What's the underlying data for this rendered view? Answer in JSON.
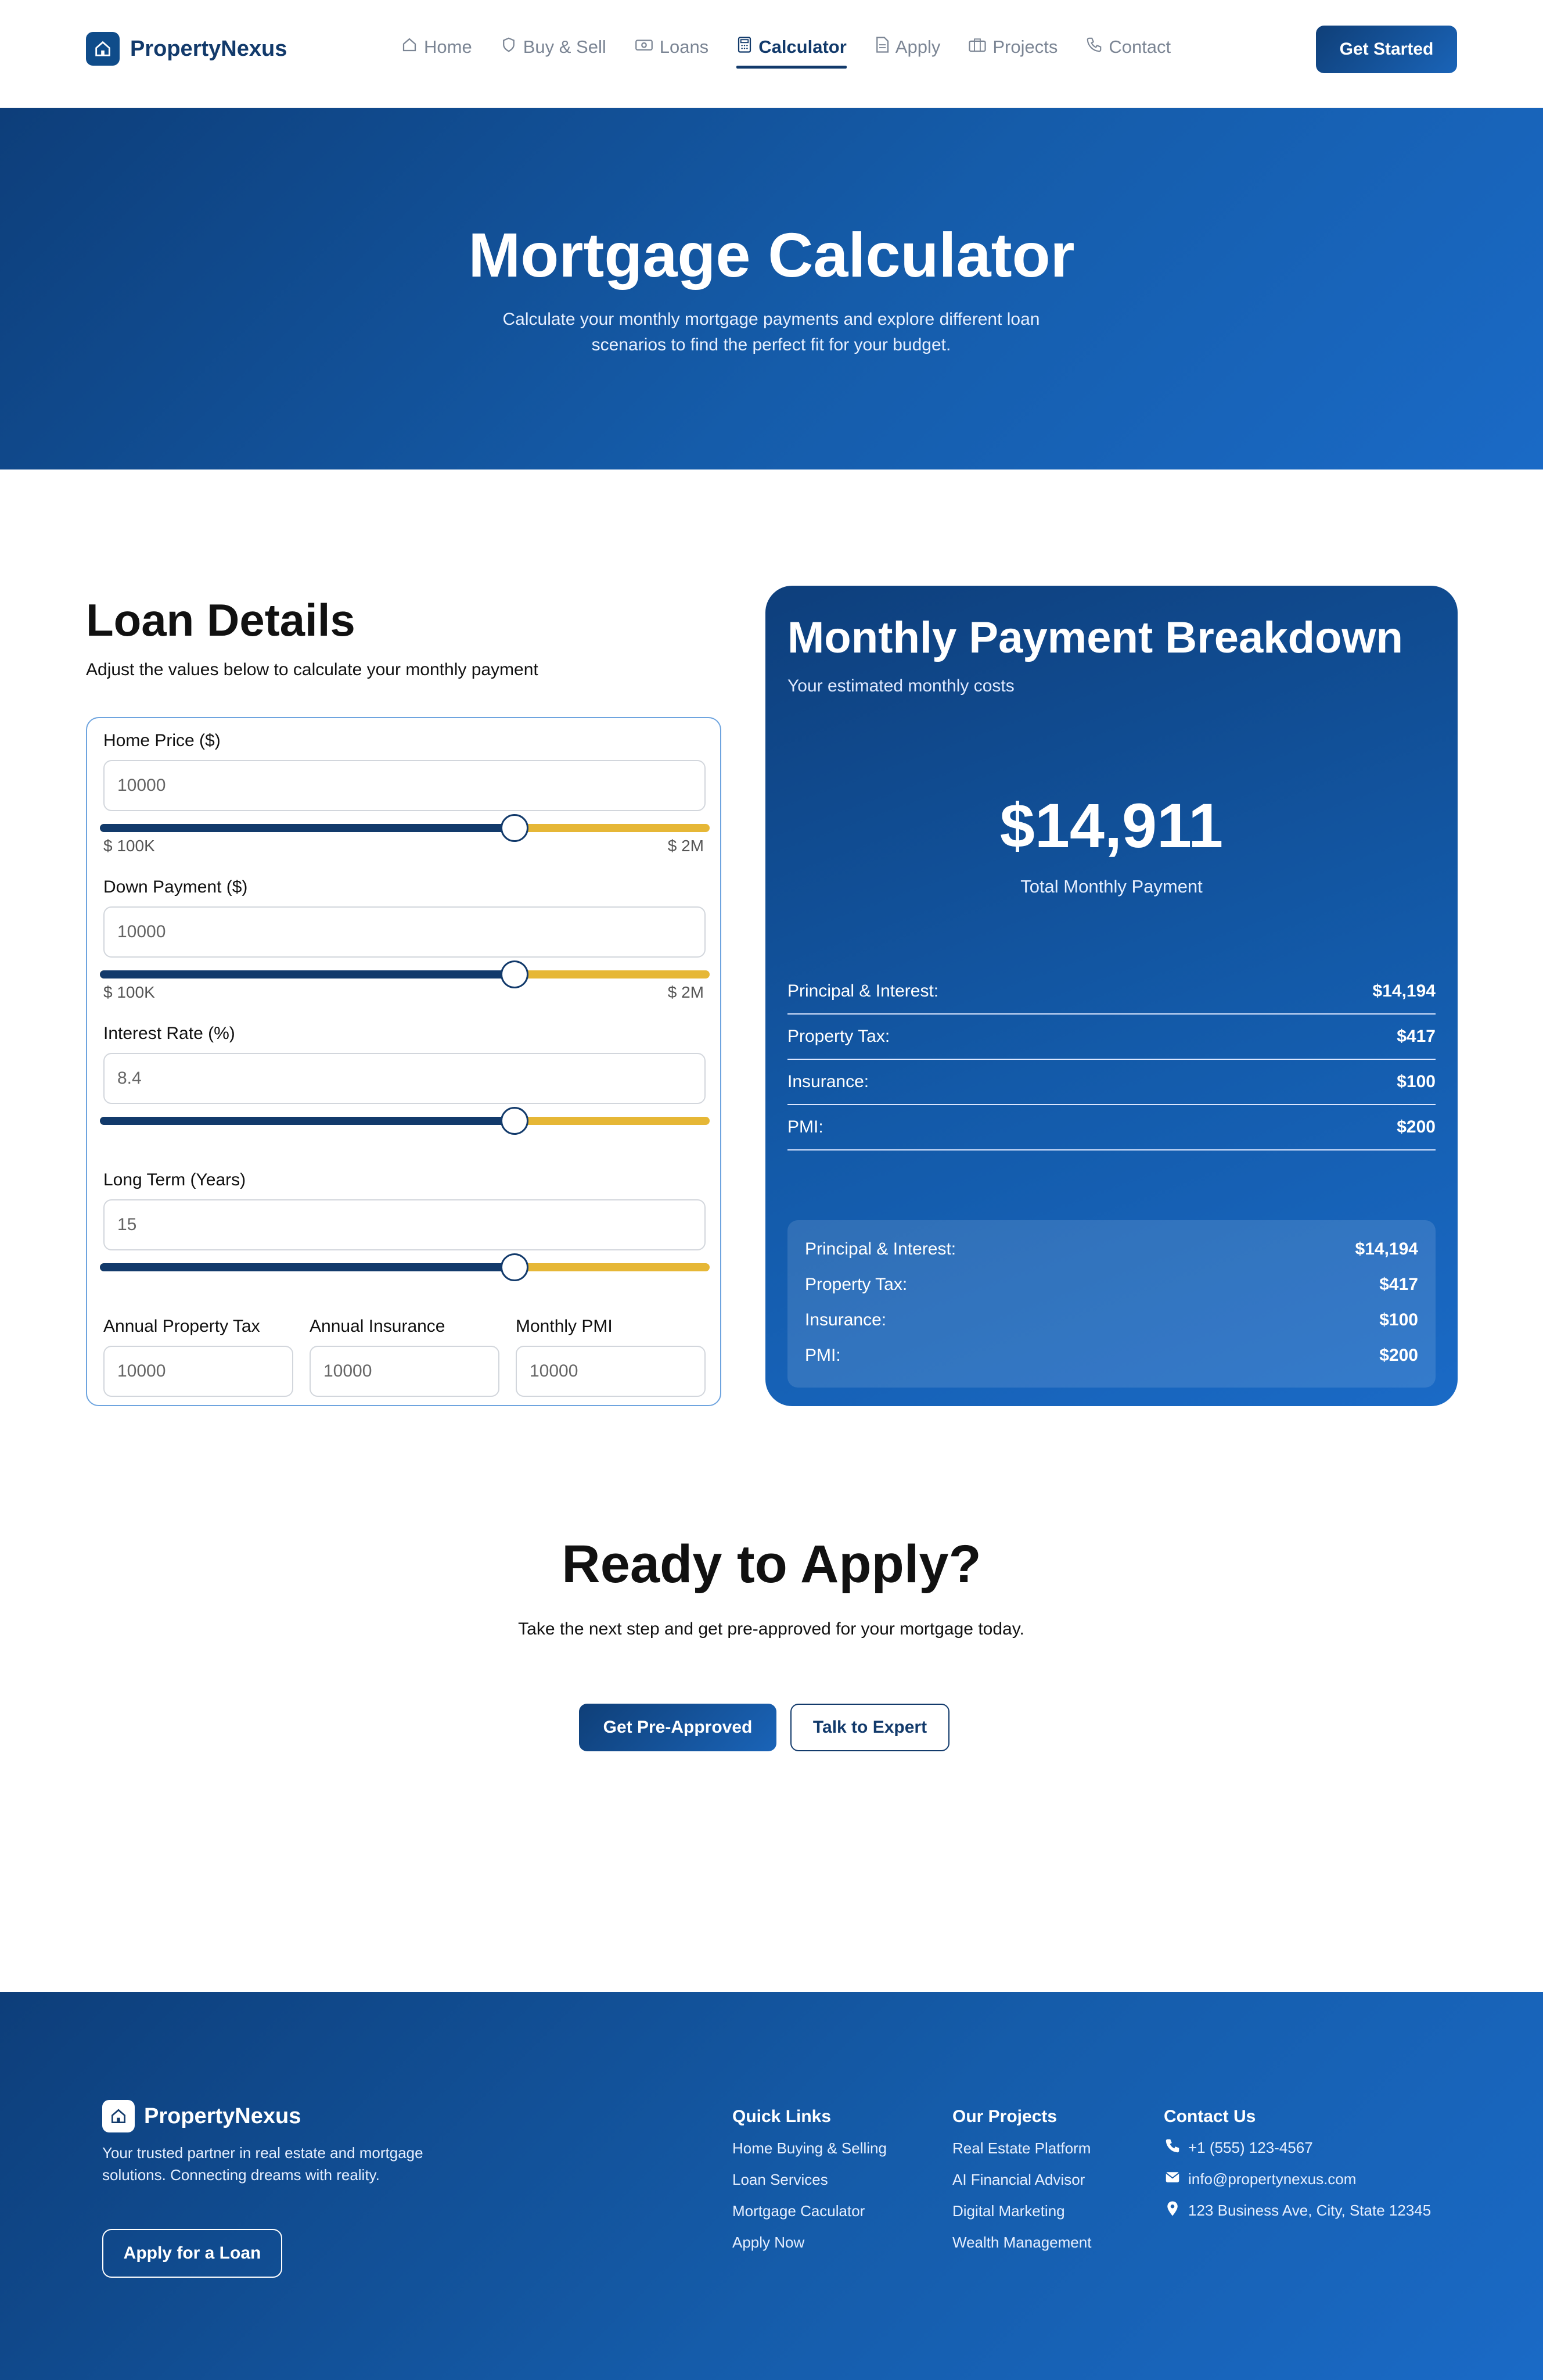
{
  "brand": {
    "name": "PropertyNexus"
  },
  "nav": {
    "links": [
      {
        "label": "Home",
        "icon": "home-icon"
      },
      {
        "label": "Buy & Sell",
        "icon": "shield-icon"
      },
      {
        "label": "Loans",
        "icon": "banknote-icon"
      },
      {
        "label": "Calculator",
        "icon": "calculator-icon",
        "active": true
      },
      {
        "label": "Apply",
        "icon": "document-icon"
      },
      {
        "label": "Projects",
        "icon": "briefcase-icon"
      },
      {
        "label": "Contact",
        "icon": "phone-icon"
      }
    ],
    "cta": "Get Started"
  },
  "hero": {
    "title": "Mortgage Calculator",
    "subtitle": "Calculate your monthly mortgage payments and explore different loan scenarios to find the perfect fit for your budget."
  },
  "loan": {
    "title": "Loan Details",
    "subtitle": "Adjust the values below to calculate your monthly payment",
    "home_price": {
      "label": "Home Price ($)",
      "value": "10000",
      "min": "$ 100K",
      "max": "$ 2M",
      "slider_fraction": 0.68
    },
    "down_payment": {
      "label": "Down Payment ($)",
      "value": "10000",
      "min": "$ 100K",
      "max": "$ 2M",
      "slider_fraction": 0.68
    },
    "interest_rate": {
      "label": "Interest Rate (%)",
      "value": "8.4",
      "slider_fraction": 0.68
    },
    "loan_term": {
      "label": "Long Term (Years)",
      "value": "15",
      "slider_fraction": 0.68
    },
    "property_tax": {
      "label": "Annual Property Tax",
      "value": "10000"
    },
    "insurance": {
      "label": "Annual Insurance",
      "value": "10000"
    },
    "pmi": {
      "label": "Monthly PMI",
      "value": "10000"
    }
  },
  "breakdown": {
    "title": "Monthly Payment Breakdown",
    "subtitle": "Your estimated monthly costs",
    "total": "$14,911",
    "total_label": "Total Monthly Payment",
    "rows": [
      {
        "label": "Principal & Interest:",
        "value": "$14,194"
      },
      {
        "label": "Property Tax:",
        "value": "$417"
      },
      {
        "label": "Insurance:",
        "value": "$100"
      },
      {
        "label": "PMI:",
        "value": "$200"
      }
    ],
    "summary": [
      {
        "label": "Principal & Interest:",
        "value": "$14,194"
      },
      {
        "label": "Property Tax:",
        "value": "$417"
      },
      {
        "label": "Insurance:",
        "value": "$100"
      },
      {
        "label": "PMI:",
        "value": "$200"
      }
    ]
  },
  "cta": {
    "title": "Ready to Apply?",
    "subtitle": "Take the next step and get pre-approved for your mortgage today.",
    "primary": "Get Pre-Approved",
    "secondary": "Talk to Expert"
  },
  "footer": {
    "brand": "PropertyNexus",
    "description": "Your trusted partner in real estate and mortgage solutions. Connecting dreams with reality.",
    "apply": "Apply for a Loan",
    "quick_links": {
      "title": "Quick Links",
      "items": [
        "Home Buying & Selling",
        "Loan Services",
        "Mortgage Caculator",
        "Apply Now"
      ]
    },
    "projects": {
      "title": "Our Projects",
      "items": [
        "Real Estate Platform",
        "AI Financial Advisor",
        "Digital Marketing",
        "Wealth Management"
      ]
    },
    "contact": {
      "title": "Contact Us",
      "phone": "+1 (555) 123-4567",
      "email": "info@propertynexus.com",
      "address": "123 Business Ave, City, State 12345"
    }
  },
  "colors": {
    "primary": "#123a6b",
    "accent": "#e6b736",
    "border": "#6ea4df"
  }
}
